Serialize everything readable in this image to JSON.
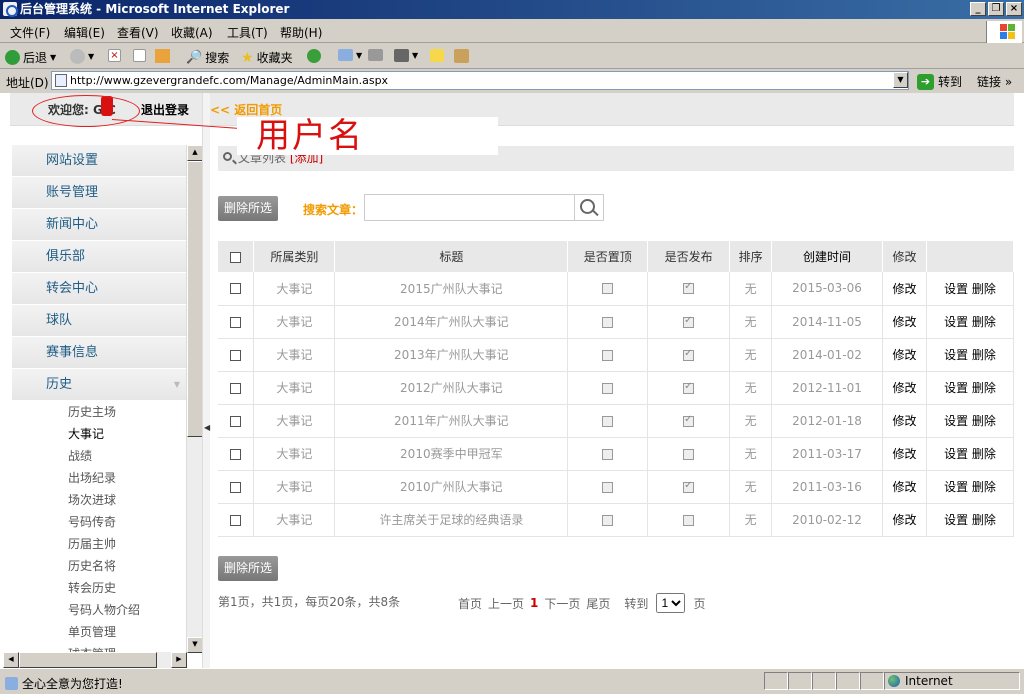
{
  "window": {
    "title": "后台管理系统 - Microsoft Internet Explorer"
  },
  "menu": [
    "文件(F)",
    "编辑(E)",
    "查看(V)",
    "收藏(A)",
    "工具(T)",
    "帮助(H)"
  ],
  "toolbar": {
    "back": "后退",
    "search": "搜索",
    "favorites": "收藏夹"
  },
  "address": {
    "label": "地址(D)",
    "url": "http://www.gzevergrandefc.com/Manage/AdminMain.aspx",
    "go": "转到",
    "links": "链接"
  },
  "topbar": {
    "welcome": "欢迎您: G    C",
    "logout": "退出登录",
    "back_home": "<< 返回首页"
  },
  "annotation": {
    "text": "用户名"
  },
  "sidebar": {
    "items": [
      "网站设置",
      "账号管理",
      "新闻中心",
      "俱乐部",
      "转会中心",
      "球队",
      "赛事信息",
      "历史"
    ],
    "sub_items": [
      "历史主场",
      "大事记",
      "战绩",
      "出场纪录",
      "场次进球",
      "号码传奇",
      "历届主帅",
      "历史名将",
      "转会历史",
      "号码人物介绍",
      "单页管理",
      "球衣管理"
    ]
  },
  "main": {
    "list_title": "文章列表",
    "add_label": "[添加]",
    "delete_selected": "删除所选",
    "search_label": "搜索文章：",
    "search_placeholder": "",
    "columns": [
      "所属类别",
      "标题",
      "是否置顶",
      "是否发布",
      "排序",
      "创建时间",
      "修改",
      ""
    ],
    "rows": [
      {
        "category": "大事记",
        "title": "2015广州队大事记",
        "pinned": false,
        "published": true,
        "order": "无",
        "date": "2015-03-06",
        "edit": "修改",
        "ops": "设置 删除"
      },
      {
        "category": "大事记",
        "title": "2014年广州队大事记",
        "pinned": false,
        "published": true,
        "order": "无",
        "date": "2014-11-05",
        "edit": "修改",
        "ops": "设置 删除"
      },
      {
        "category": "大事记",
        "title": "2013年广州队大事记",
        "pinned": false,
        "published": true,
        "order": "无",
        "date": "2014-01-02",
        "edit": "修改",
        "ops": "设置 删除"
      },
      {
        "category": "大事记",
        "title": "2012广州队大事记",
        "pinned": false,
        "published": true,
        "order": "无",
        "date": "2012-11-01",
        "edit": "修改",
        "ops": "设置 删除"
      },
      {
        "category": "大事记",
        "title": "2011年广州队大事记",
        "pinned": false,
        "published": true,
        "order": "无",
        "date": "2012-01-18",
        "edit": "修改",
        "ops": "设置 删除"
      },
      {
        "category": "大事记",
        "title": "2010赛季中甲冠军",
        "pinned": false,
        "published": false,
        "order": "无",
        "date": "2011-03-17",
        "edit": "修改",
        "ops": "设置 删除"
      },
      {
        "category": "大事记",
        "title": "2010广州队大事记",
        "pinned": false,
        "published": true,
        "order": "无",
        "date": "2011-03-16",
        "edit": "修改",
        "ops": "设置 删除"
      },
      {
        "category": "大事记",
        "title": "许主席关于足球的经典语录",
        "pinned": false,
        "published": false,
        "order": "无",
        "date": "2010-02-12",
        "edit": "修改",
        "ops": "设置 删除"
      }
    ],
    "pager_info": "第1页，共1页，每页20条，共8条",
    "pager": {
      "first": "首页",
      "prev": "上一页",
      "current": "1",
      "next": "下一页",
      "last": "尾页",
      "goto": "转到",
      "page_select": "1",
      "page_unit": "页"
    }
  },
  "status": {
    "text": "全心全意为您打造!",
    "zone": "Internet"
  }
}
